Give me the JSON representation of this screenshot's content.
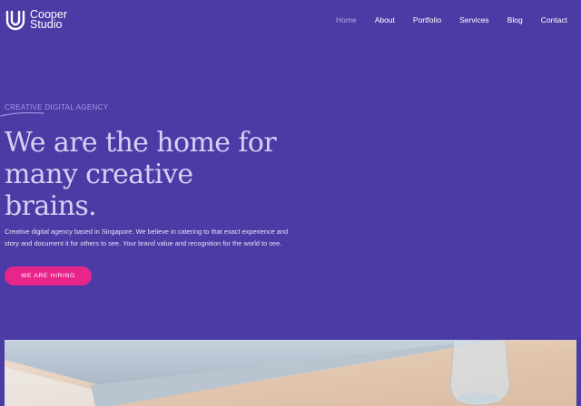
{
  "brand": {
    "line1": "Cooper",
    "line2": "Studio"
  },
  "nav": {
    "items": [
      {
        "label": "Home",
        "active": true
      },
      {
        "label": "About",
        "active": false
      },
      {
        "label": "Portfolio",
        "active": false
      },
      {
        "label": "Services",
        "active": false
      },
      {
        "label": "Blog",
        "active": false
      },
      {
        "label": "Contact",
        "active": false
      }
    ]
  },
  "hero": {
    "kicker_accent": "CREATIVE",
    "kicker_rest": " DIGITAL AGENCY",
    "headline_line1": "We are the home for",
    "headline_line2": "many creative",
    "headline_line3": "brains.",
    "description_line1": "Creative digital agency based in Singapore. We believe in catering to that exact experience and",
    "description_line2": "story and document it for others to see. Your brand value and recognition for the world to see.",
    "cta_label": "WE ARE HIRING"
  },
  "colors": {
    "background": "#4b3ba5",
    "accent": "#e8258a",
    "kicker": "#a899e8",
    "headline": "#d7d0f5"
  },
  "icons": {
    "logo": "concentric-u-logo-icon"
  }
}
